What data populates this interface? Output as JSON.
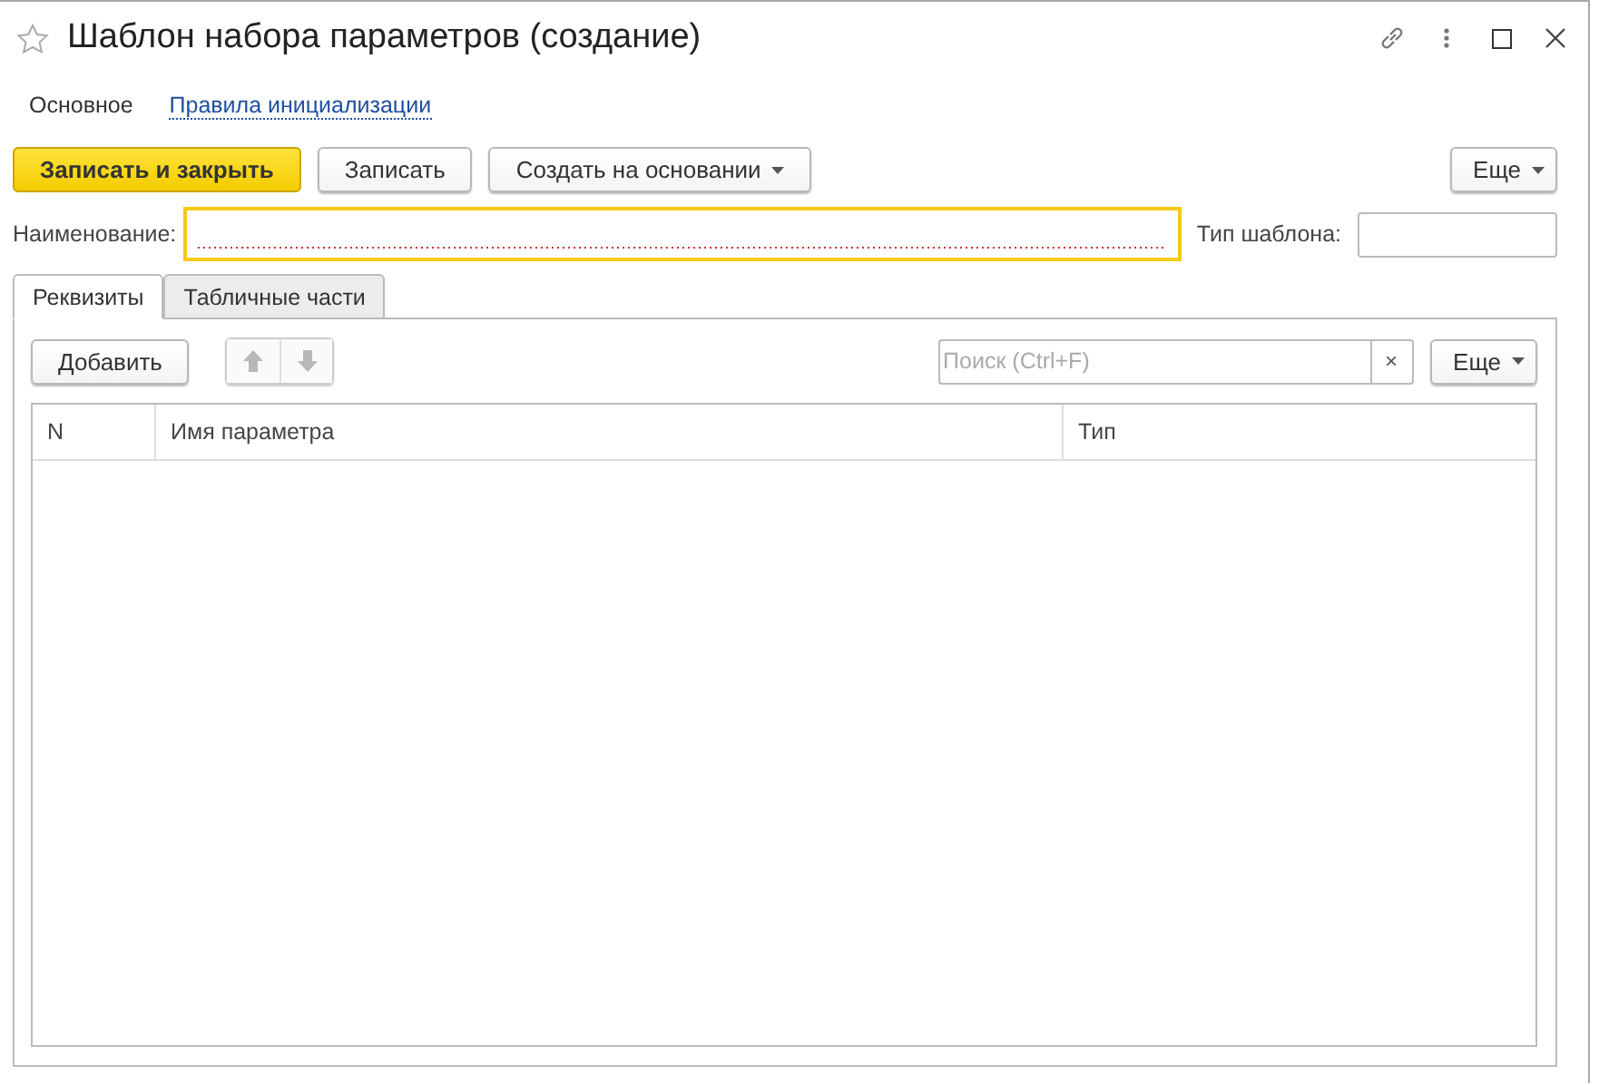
{
  "window": {
    "title": "Шаблон набора параметров (создание)",
    "favorite": false
  },
  "nav": [
    {
      "label": "Основное",
      "selected": true
    },
    {
      "label": "Правила инициализации",
      "selected": false
    }
  ],
  "toolbar": {
    "buttons": [
      {
        "label": "Записать и закрыть",
        "kind": "primary"
      },
      {
        "label": "Записать",
        "kind": "plain"
      },
      {
        "label": "Создать на основании",
        "kind": "menu"
      }
    ],
    "more": "Еще"
  },
  "fields": {
    "name": {
      "label": "Наименование:",
      "focused": true
    },
    "template_type": {
      "label": "Тип шаблона:"
    }
  },
  "tabs": [
    {
      "label": "Реквизиты",
      "selected": true
    },
    {
      "label": "Табличные части",
      "selected": false
    }
  ],
  "table_toolbar": {
    "add": "Добавить",
    "move_up": {
      "disabled": true
    },
    "move_down": {
      "disabled": true
    },
    "search": {
      "placeholder": "Поиск (Ctrl+F)",
      "clear": "×"
    },
    "more": "Еще"
  },
  "table": {
    "columns": [
      "N",
      "Имя параметра",
      "Тип"
    ]
  }
}
